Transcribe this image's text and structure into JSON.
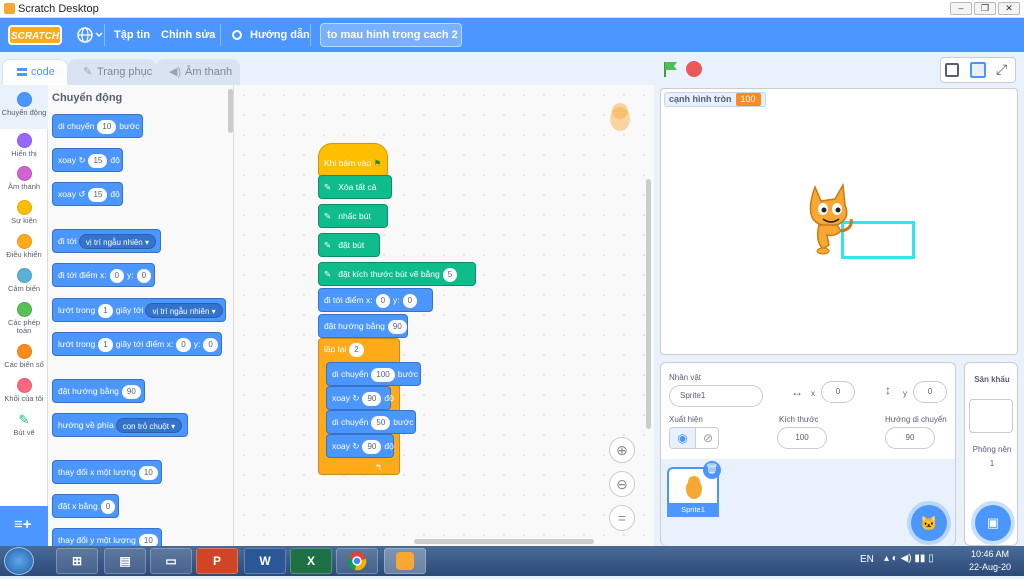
{
  "window": {
    "title": "Scratch Desktop",
    "controls": [
      "–",
      "❐",
      "✕"
    ]
  },
  "menu": {
    "logo": "SCRATCH",
    "file": "Tập tin",
    "edit": "Chỉnh sửa",
    "tutorials": "Hướng dẫn",
    "project_name": "to mau hinh trong cach 2"
  },
  "tabs": {
    "code": "code",
    "costumes": "Trang phục",
    "sounds": "Âm thanh"
  },
  "categories": [
    {
      "label": "Chuyển động",
      "color": "#4c97ff"
    },
    {
      "label": "Hiển thị",
      "color": "#9966ff"
    },
    {
      "label": "Âm thanh",
      "color": "#cf63cf"
    },
    {
      "label": "Sự kiện",
      "color": "#ffbf00"
    },
    {
      "label": "Điều khiển",
      "color": "#ffab19"
    },
    {
      "label": "Cảm biến",
      "color": "#5cb1d6"
    },
    {
      "label": "Các phép toán",
      "color": "#59c059"
    },
    {
      "label": "Các biến số",
      "color": "#ff8c1a"
    },
    {
      "label": "Khối của tôi",
      "color": "#ff6680"
    },
    {
      "label": "Bút vẽ",
      "color": "#0fbd8c"
    }
  ],
  "palette": {
    "heading": "Chuyển động",
    "move": {
      "text": "di chuyển",
      "value": "10",
      "suffix": "bước"
    },
    "turn_right": {
      "text": "xoay",
      "value": "15",
      "suffix": "độ"
    },
    "turn_left": {
      "text": "xoay",
      "value": "15",
      "suffix": "độ"
    },
    "goto": {
      "text": "đi tới",
      "dropdown": "vị trí ngẫu nhiên"
    },
    "goto_xy": {
      "text": "đi tới điểm x:",
      "x": "0",
      "ylabel": "y:",
      "y": "0"
    },
    "glide": {
      "text": "lướt trong",
      "value": "1",
      "mid": "giây tới",
      "dropdown": "vị trí ngẫu nhiên"
    },
    "glide_xy": {
      "text": "lướt trong",
      "value": "1",
      "mid": "giây tới điểm x:",
      "x": "0",
      "ylabel": "y:",
      "y": "0"
    },
    "point_dir": {
      "text": "đặt hướng bằng",
      "value": "90"
    },
    "point_towards": {
      "text": "hướng về phía",
      "dropdown": "con trỏ chuột"
    },
    "change_x": {
      "text": "thay đổi x một lượng",
      "value": "10"
    },
    "set_x": {
      "text": "đặt x bằng",
      "value": "0"
    },
    "change_y": {
      "text": "thay đổi y một lượng",
      "value": "10"
    }
  },
  "script": {
    "hat": "Khi bấm vào",
    "clear": "Xóa tất cả",
    "pen_up": "nhấc bút",
    "pen_down": "đặt bút",
    "pen_size": {
      "text": "đặt kích thước bút vẽ bằng",
      "value": "5"
    },
    "goto_xy": {
      "text": "đi tới điểm x:",
      "x": "0",
      "ylabel": "y:",
      "y": "0"
    },
    "point_dir": {
      "text": "đặt hướng bằng",
      "value": "90"
    },
    "repeat": {
      "text": "lặp lại",
      "value": "2"
    },
    "move1": {
      "text": "di chuyển",
      "value": "100",
      "suffix": "bước"
    },
    "turn1": {
      "text": "xoay",
      "value": "90",
      "suffix": "độ"
    },
    "move2": {
      "text": "di chuyển",
      "value": "50",
      "suffix": "bước"
    },
    "turn2": {
      "text": "xoay",
      "value": "90",
      "suffix": "độ"
    }
  },
  "stage": {
    "monitor_label": "cạnh hình tròn",
    "monitor_value": "100"
  },
  "sprite_info": {
    "sprite_label": "Nhân vật",
    "sprite_name": "Sprite1",
    "x_label": "x",
    "x": "0",
    "y_label": "y",
    "y": "0",
    "show_label": "Xuất hiện",
    "size_label": "Kích thước",
    "size": "100",
    "direction_label": "Hướng di chuyển",
    "direction": "90",
    "thumb_label": "Sprite1"
  },
  "stage_pane": {
    "title": "Sân khấu",
    "backdrops_label": "Phông nền",
    "backdrops_count": "1"
  },
  "taskbar": {
    "lang": "EN",
    "time": "10:46 AM",
    "date": "22-Aug-20"
  },
  "colors": {
    "motion": "#4c97ff",
    "pen": "#0fbd8c",
    "events": "#ffbf00",
    "control": "#ffab19",
    "menubar": "#4c97ff"
  }
}
